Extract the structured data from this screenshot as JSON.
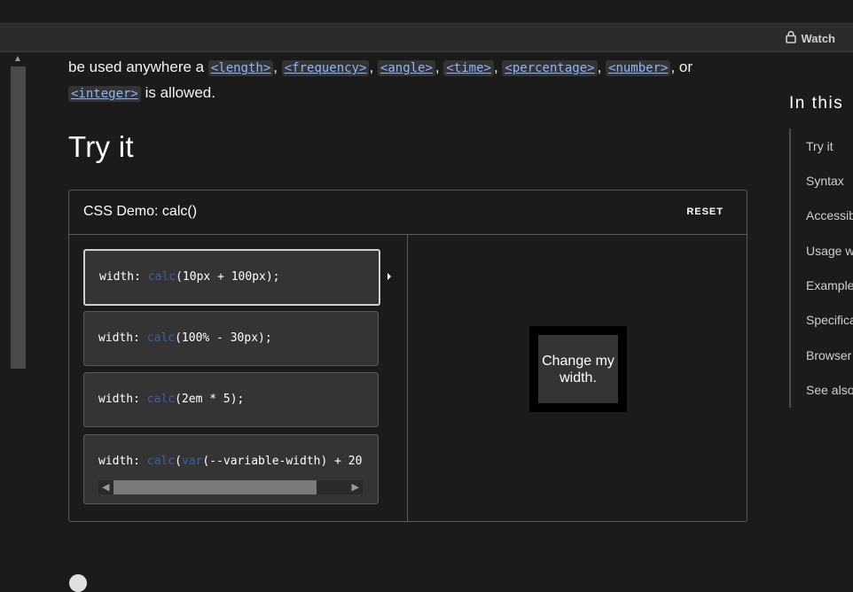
{
  "header": {
    "watch_label": "Watch",
    "watch_icon": "lock-icon"
  },
  "prose": {
    "line1_prefix": "be used anywhere a ",
    "types": [
      "<length>",
      "<frequency>",
      "<angle>",
      "<time>",
      "<percentage>",
      "<number>"
    ],
    "sep": ", ",
    "or_text": ", or",
    "last_type": "<integer>",
    "suffix": " is allowed."
  },
  "section_title": "Try it",
  "demo": {
    "title": "CSS Demo: calc()",
    "reset_label": "RESET",
    "choices": [
      {
        "prop": "width: ",
        "fn": "calc",
        "args": "(10px + 100px);",
        "selected": true
      },
      {
        "prop": "width: ",
        "fn": "calc",
        "args": "(100% - 30px);",
        "selected": false
      },
      {
        "prop": "width: ",
        "fn": "calc",
        "args": "(2em * 5);",
        "selected": false
      },
      {
        "prop": "width: ",
        "fn": "calc",
        "args": "(",
        "fn2": "var",
        "args2": "(--variable-width) + 20",
        "selected": false
      }
    ],
    "output_text": "Change my width."
  },
  "toc": {
    "title": "In this",
    "items": [
      "Try it",
      "Syntax",
      "Accessib",
      "Usage w",
      "Example",
      "Specifica",
      "Browser",
      "See also"
    ]
  },
  "colors": {
    "background": "#1b1b1b",
    "link": "#8cb4ff",
    "keyword": "#3d5ea8"
  }
}
